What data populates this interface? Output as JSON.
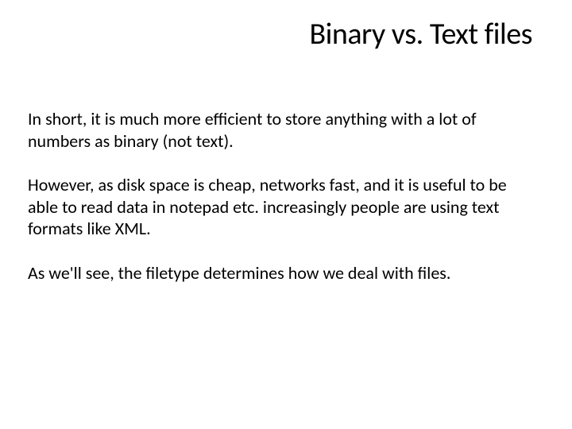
{
  "slide": {
    "title": "Binary vs. Text files",
    "paragraphs": [
      "In short, it is much more efficient to store anything with a lot of numbers as binary (not text).",
      "However, as disk space is cheap, networks fast, and it is useful to be able to read data in notepad etc. increasingly people are using text formats like XML.",
      "As we'll see, the filetype determines how we deal with files."
    ]
  }
}
